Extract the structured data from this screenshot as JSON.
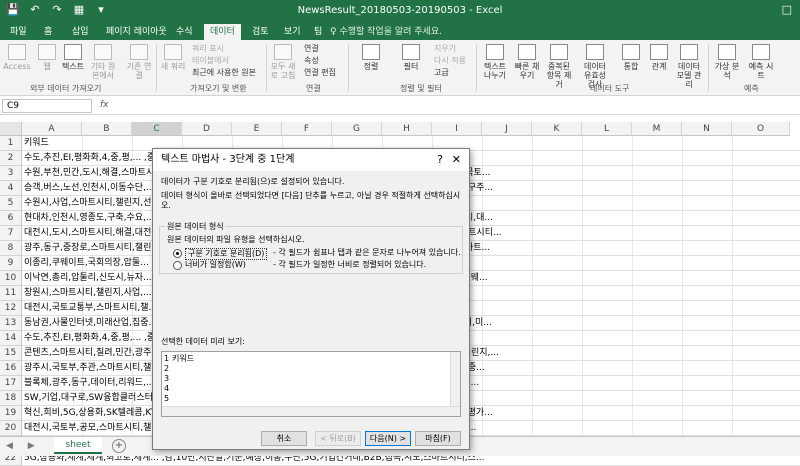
{
  "titlebar": {
    "title": "NewsResult_20180503-20190503 - Excel",
    "qat": [
      "💾",
      "↶",
      "↷",
      "▦",
      "▾"
    ],
    "window_controls": "□"
  },
  "tabs": {
    "items": [
      "파일",
      "홈",
      "삽입",
      "페이지 레이아웃",
      "수식",
      "데이터",
      "검토",
      "보기",
      "팀"
    ],
    "active": "데이터",
    "tellme": "♀ 수행할 작업을 알려 주세요."
  },
  "ribbon": {
    "access": "Access",
    "web": "웹",
    "text": "텍스트",
    "other_sources": "기타 원본에서",
    "existing": "기존 연결",
    "new_query": "새 쿼리",
    "show_query": "쿼리 표시",
    "from_table": "테이블에서",
    "recent": "최근에 사용한 원본",
    "refresh_all": "모두 새로 고침",
    "connections": "연결",
    "properties": "속성",
    "edit_links": "연결 편집",
    "sort": "정렬",
    "filter": "필터",
    "clear": "지우기",
    "reapply": "다시 적용",
    "advanced": "고급",
    "text_to_columns": "텍스트 나누기",
    "flash_fill": "빠른 채우기",
    "remove_dup": "중복된 항목 제거",
    "validation": "데이터 유효성 검사",
    "consolidate": "통합",
    "relationships": "관계",
    "data_model": "데이터 모델 관리",
    "whatif": "가상 분석",
    "forecast": "예측 시트",
    "groups": {
      "external": "외부 데이터 가져오기",
      "transform": "가져오기 및 변환",
      "connections": "연결",
      "sort_filter": "정렬 및 필터",
      "tools": "데이터 도구",
      "forecast": "예측"
    }
  },
  "formula_bar": {
    "name_box": "C9",
    "fx": "fx"
  },
  "grid": {
    "columns": [
      "A",
      "B",
      "C",
      "D",
      "E",
      "F",
      "G",
      "H",
      "I",
      "J",
      "K",
      "L",
      "M",
      "N",
      "O"
    ],
    "selected_column": "C",
    "rows": [
      {
        "n": "1",
        "text": "키워드"
      },
      {
        "n": "2",
        "text": "수도,추진,EI,평화화,4,중,평,...                                               ,중,중,울산광역시,남울란웨시쿠,유력,수도,이전지,혁지,언론,2일,일각,초대,수카..."
      },
      {
        "n": "3",
        "text": "수원,부천,민간,도시,해결,스마트시...                                           ,지방자치단체,전국,6,갈,민간,도시문제,해결,스마트시티,챌린지,사업,공모,선정,국토..."
      },
      {
        "n": "4",
        "text": "승객,버스,노선,인천시,이동수단,...                                             ,해행,승객,수요,실시간,노선,맞춤형,버스,생성,신개념,대중교통,인천,영종국제도시,구주..."
      },
      {
        "n": "5",
        "text": "수원시,사업,스마트시티,챌린지,선정...                                          ,챌린지,공모,사업,대상지,선정,수원시,국토교통부,수원시,6개,지방자치단체..."
      },
      {
        "n": "6",
        "text": "현대차,인천시,영종도,구축,수요,...                                             ,스마트시티,시범,사업,선정,국토부,인천시,광주시,경기도,부천시,수원시,경남,창원시,대..."
      },
      {
        "n": "7",
        "text": "대전시,도시,스마트시티,해결,대전...                                            ,이용,챌린지,국도부,신청,대전,전국,유일,선정,시,5일,대전시,서울,선정,수도,스마트시티..."
      },
      {
        "n": "8",
        "text": "광주,동구,중장로,스마트시티,챌린...                                            ,민간,사업,광주광역시,선정,중장로,중앙,불투체,데이터,리워드,클랜,구축,사업,스마트..."
      },
      {
        "n": "9",
        "text": "이종리,쿠웨이트,국회의장,압둘...                                               ,쿠웨이트,국회,마르주크,알리,가님,쿠웨이트,국회의장,쿠웨이트,국회,한국,기업..."
      },
      {
        "n": "10",
        "text": "이낙연,총리,압둘리,신도시,뉴자...                                             ,당국,너지,요청,협력,강화,쿠웨이트,비즈니스,포럼,이낙연,국무총리,2일,현지시간,쿠웨..."
      },
      {
        "n": "11",
        "text": "창원시,스마트시티,챌린지,사업,...                                             ,아이디어,도시문제,해결,사업,지자체,응모,최종선,창원시,6곳,창원시,사업,스..."
      },
      {
        "n": "12",
        "text": "대전시,국토교통부,스마트시티,챌...                                            ,대상,도시,선정,2일,사업,스마트시티,챌린지,공,도시문제,스마트시티,해결,대..."
      },
      {
        "n": "13",
        "text": "동남권,사물인터넷,미래산업,집중...                                            ,74%,7.2%,첨단제조,스마트,4차,실증,플래이어,확보,시대,4차,산업혁명,빅데이터,미..."
      },
      {
        "n": "14",
        "text": "수도,추진,EI,평화화,4,중,평,...                                               ,중,울산광역시,남울란웨시쿠,4중,유력,수도,이전지,혁지,언론,2일,일각,초대,수카..."
      },
      {
        "n": "15",
        "text": "콘텐츠,스마트시티,칠려,민간,광주...                                           ,광주시,경기,부천,경남,창원,대전,인천,6곳,2일,광주시,국토부,사업,스마트시티,챌린지,..."
      },
      {
        "n": "16",
        "text": "광주시,국토부,주관,스마트시티,챌...                                           ,후,국토교통부,주관,스마트시티,챌린지,공모,1단계,사업,광주광역시,선정,중장로,중..."
      },
      {
        "n": "17",
        "text": "블록체,광주,동구,데이터,리워드,...                                            ,채,국토교통부,주관,스마트시티,챌린지,공모,1단계,사업,광주광역시,선정,중장로,중..."
      },
      {
        "n": "18",
        "text": "SW,기업,대구로,SW융합클러스터,...                                            ,5W,기업,5000여명,SW,전문인력,근무,집적단지,대구시,SW,융합..."
      },
      {
        "n": "19",
        "text": "혁신,희비,5G,상용화,SK텔레콤,KT...                                            ,성공,가능성,확인,5G,상용화,조기,커버리지,논란,서비스,불안정,지속,절반,성공,평가..."
      },
      {
        "n": "20",
        "text": "대전시,국토부,공모,스마트시티,챌...                                           ,사업,대상,도시,선정,2일,사업,스마트시티,챌린지,도시문제,스마트시티,해결,대전..."
      },
      {
        "n": "21",
        "text": "논란,유영민,장관,5G,품질,자산,진...                                           ,관,5G,품질,자산,진단,기존,대비,단계,LTE,전국,커버리지,불편,스마트폰,기업,해..."
      },
      {
        "n": "22",
        "text": "5G,상용화,세계,세계,최고로,세계...                                           ,감,10만,지난달,기준,예상,이통,수단,5G,기업간거래,B2B,접목,시도,스마트시티,스..."
      }
    ]
  },
  "sheet": {
    "nav": "◀ ▶",
    "tab": "sheet",
    "add": "+"
  },
  "dialog": {
    "title": "텍스트 마법사 - 3단계 중 1단계",
    "help": "?",
    "close": "✕",
    "line1": "데이터가 구분 기호로 분리됨(으)로 설정되어 있습니다.",
    "line2": "데이터 형식이 올바로 선택되었다면 [다음] 단추를 누르고, 아닐 경우 적절하게 선택하십시오.",
    "section": "원본 데이터 형식",
    "instruction": "원본 데이터의 파일 유형을 선택하십시오.",
    "opt1_label": "구분 기호로 분리됨(D)",
    "opt1_desc": "- 각 필드가 쉼표나 탭과 같은 문자로 나누어져 있습니다.",
    "opt2_label": "너비가 일정함(W)",
    "opt2_desc": "- 각 필드가 일정한 너비로 정렬되어 있습니다.",
    "preview_label": "선택한 데이터 미리 보기:",
    "preview_rows": [
      {
        "n": "1",
        "text": "키워드"
      },
      {
        "n": "2",
        "text": ""
      },
      {
        "n": "3",
        "text": ""
      },
      {
        "n": "4",
        "text": ""
      },
      {
        "n": "5",
        "text": ""
      }
    ],
    "buttons": {
      "cancel": "취소",
      "back": "< 뒤로(B)",
      "next": "다음(N) >",
      "finish": "마침(F)"
    }
  },
  "colors": {
    "brand": "#217346",
    "dialog_bg": "#f0f0f0",
    "primary_button_border": "#0078d7"
  }
}
